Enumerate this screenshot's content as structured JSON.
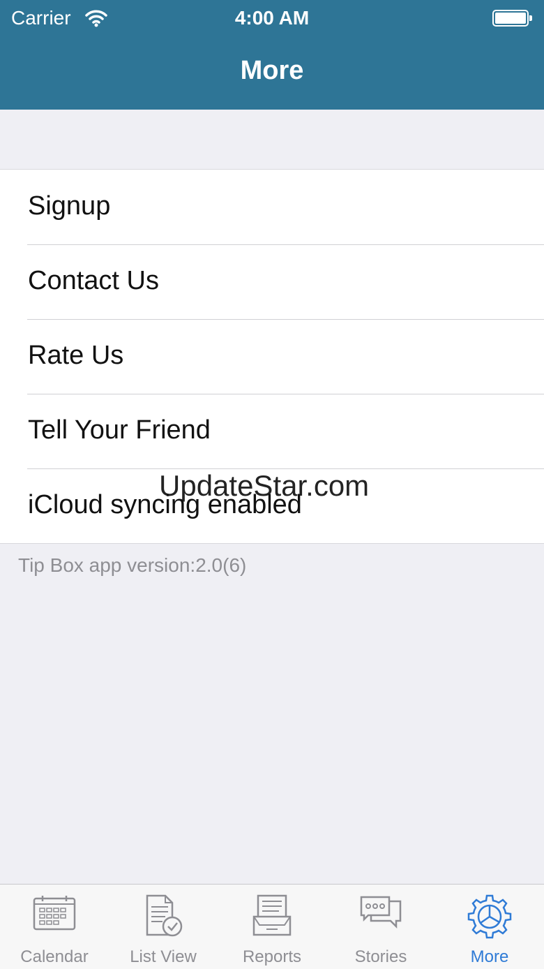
{
  "status_bar": {
    "carrier": "Carrier",
    "time": "4:00 AM"
  },
  "nav": {
    "title": "More"
  },
  "menu": {
    "items": [
      {
        "label": "Signup"
      },
      {
        "label": "Contact Us"
      },
      {
        "label": "Rate Us"
      },
      {
        "label": "Tell Your Friend"
      },
      {
        "label": "iCloud syncing enabled"
      }
    ]
  },
  "footer": {
    "version_text": "Tip Box app version:2.0(6)"
  },
  "watermark": {
    "text": "UpdateStar.com"
  },
  "tabbar": {
    "tabs": [
      {
        "label": "Calendar",
        "icon": "calendar-icon"
      },
      {
        "label": "List View",
        "icon": "list-check-icon"
      },
      {
        "label": "Reports",
        "icon": "reports-icon"
      },
      {
        "label": "Stories",
        "icon": "stories-icon"
      },
      {
        "label": "More",
        "icon": "settings-gear-icon"
      }
    ],
    "active_color": "#2f7bd6",
    "inactive_color": "#8e8e93"
  },
  "colors": {
    "header": "#2e7596",
    "background": "#efeff4"
  }
}
